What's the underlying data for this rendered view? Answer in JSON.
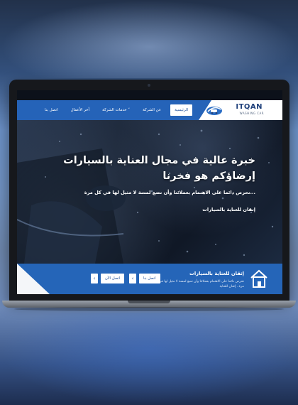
{
  "site": {
    "logo": {
      "name": "ITQAN",
      "tagline": "WASHING CAR"
    },
    "nav": {
      "items": [
        {
          "label": "الرئيسية",
          "active": true
        },
        {
          "label": "عن الشركة"
        },
        {
          "label": "خدمات الشركة ˅"
        },
        {
          "label": "آخر الأعمال"
        },
        {
          "label": "اتصل بنا"
        }
      ]
    },
    "hero": {
      "title_line1": "خبرة عالية في مجال العناية بالسيارات",
      "title_line2": "إرضاؤكم هو فخرنا",
      "description": "نحرص دائما على الاهتمام بعملائنا وأن نضع لمسة لا مثيل لها في كل مرة...",
      "tagline": "إتقان للعناية بالسيارات"
    },
    "feature": {
      "title": "إتقان للعناية بالسيارات",
      "text": "نحرص دائما على الاهتمام بعملائنا وأن نضع لمسة لا مثيل لها في كل مرة.. إتقان للعناية",
      "primary_button": "اتصل بنا",
      "secondary_button": "اتصل الآن",
      "arrow_glyph": "‹"
    }
  },
  "colors": {
    "brand_blue": "#2565b8",
    "dark": "#16181c"
  }
}
